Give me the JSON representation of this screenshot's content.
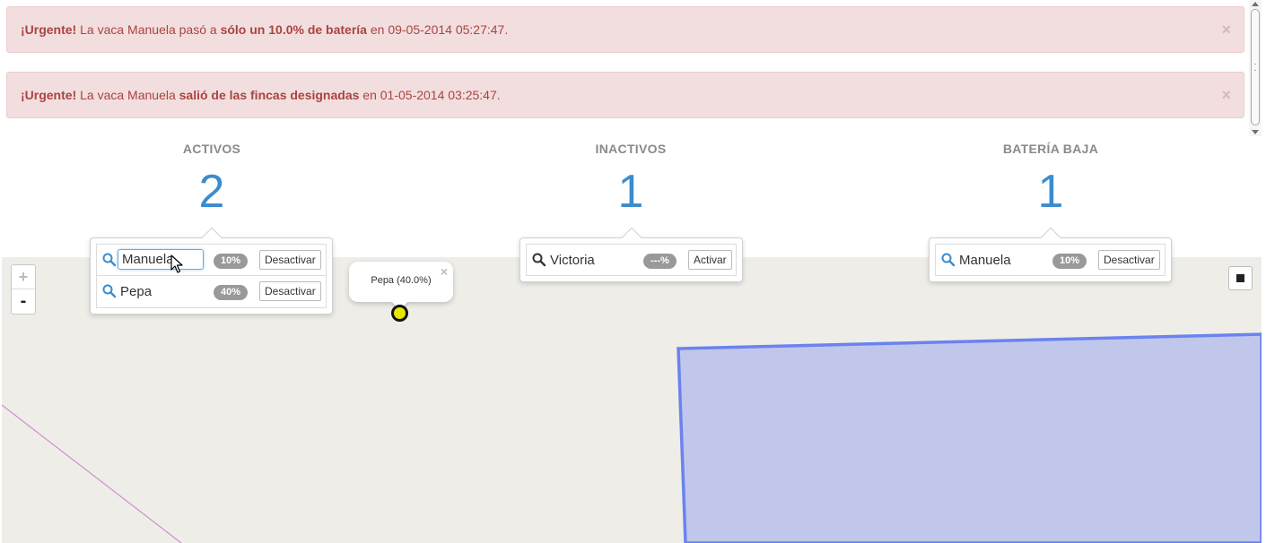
{
  "alerts": [
    {
      "prefix": "¡Urgente!",
      "text1": " La vaca Manuela pasó a ",
      "bold": "sólo un 10.0% de batería",
      "text2": " en 09-05-2014 05:27:47.",
      "close": "×"
    },
    {
      "prefix": "¡Urgente!",
      "text1": " La vaca Manuela ",
      "bold": "salió de las fincas designadas",
      "text2": " en 01-05-2014 03:25:47.",
      "close": "×"
    }
  ],
  "stats": {
    "active": {
      "title": "ACTIVOS",
      "value": "2"
    },
    "inactive": {
      "title": "INACTIVOS",
      "value": "1"
    },
    "low_battery": {
      "title": "BATERÍA BAJA",
      "value": "1"
    }
  },
  "popovers": {
    "active": [
      {
        "name": "Manuela",
        "badge": "10%",
        "button": "Desactivar"
      },
      {
        "name": "Pepa",
        "badge": "40%",
        "button": "Desactivar"
      }
    ],
    "inactive": [
      {
        "name": "Victoria",
        "badge": "---%",
        "button": "Activar"
      }
    ],
    "low_battery": [
      {
        "name": "Manuela",
        "badge": "10%",
        "button": "Desactivar"
      }
    ]
  },
  "map": {
    "zoom_in": "+",
    "zoom_out": "-",
    "popup_text": "Pepa (40.0%)",
    "popup_close": "×",
    "marker_color": "#e6e600",
    "polygon_fill": "#c1c7eb",
    "polygon_stroke": "#6b82f0",
    "line_color": "#cf8fcf"
  },
  "colors": {
    "alert_bg": "#f2dede",
    "alert_text": "#a94442",
    "stat_number": "#3a8ccf",
    "map_bg": "#efede8"
  }
}
